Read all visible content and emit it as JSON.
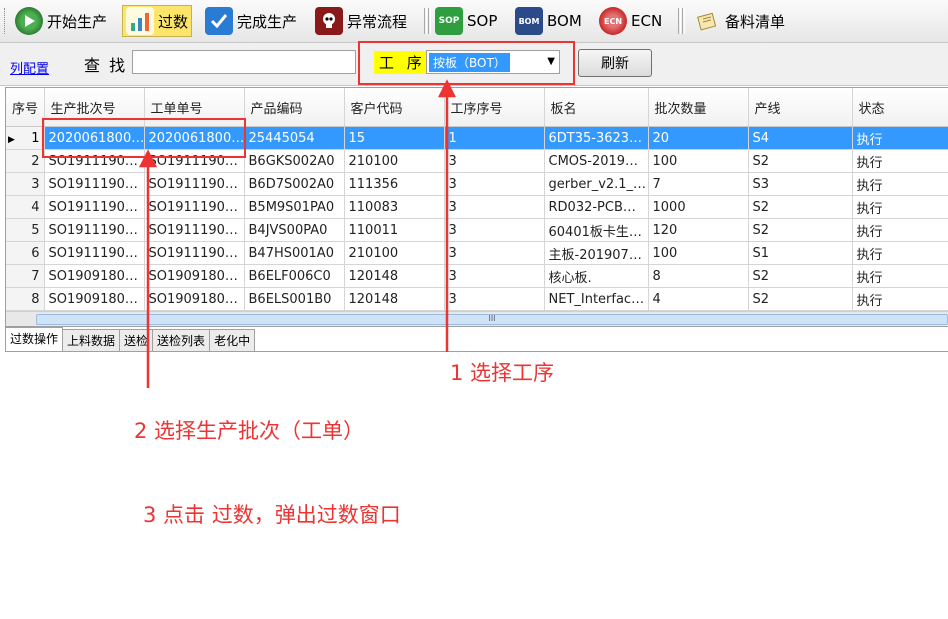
{
  "toolbar": {
    "items": [
      {
        "label": "开始生产",
        "icon": "play-icon"
      },
      {
        "label": "过数",
        "icon": "count-icon"
      },
      {
        "label": "完成生产",
        "icon": "done-icon"
      },
      {
        "label": "异常流程",
        "icon": "skull-icon"
      },
      {
        "label": "SOP",
        "icon": "sop-icon"
      },
      {
        "label": "BOM",
        "icon": "bom-icon"
      },
      {
        "label": "ECN",
        "icon": "ecn-icon"
      },
      {
        "label": "备料清单",
        "icon": "notebook-icon"
      }
    ],
    "active_index": 1
  },
  "filter": {
    "column_config_link": "列配置",
    "find_label": "查 找",
    "find_value": "",
    "process_label": "工 序",
    "process_value": "按板（BOT）",
    "refresh_label": "刷新"
  },
  "grid": {
    "columns": [
      "序号",
      "生产批次号",
      "工单单号",
      "产品编码",
      "客户代码",
      "工序序号",
      "板名",
      "批次数量",
      "产线",
      "状态"
    ],
    "rows": [
      [
        "1",
        "2020061800…",
        "2020061800…",
        "25445054",
        "15",
        "1",
        "6DT35-3623…",
        "20",
        "S4",
        "执行"
      ],
      [
        "2",
        "SO1911190…",
        "SO1911190…",
        "B6GKS002A0",
        "210100",
        "3",
        "CMOS-2019…",
        "100",
        "S2",
        "执行"
      ],
      [
        "3",
        "SO1911190…",
        "SO1911190…",
        "B6D7S002A0",
        "111356",
        "3",
        "gerber_v2.1_…",
        "7",
        "S3",
        "执行"
      ],
      [
        "4",
        "SO1911190…",
        "SO1911190…",
        "B5M9S01PA0",
        "110083",
        "3",
        "RD032-PCB…",
        "1000",
        "S2",
        "执行"
      ],
      [
        "5",
        "SO1911190…",
        "SO1911190…",
        "B4JVS00PA0",
        "110011",
        "3",
        "60401板卡生…",
        "120",
        "S2",
        "执行"
      ],
      [
        "6",
        "SO1911190…",
        "SO1911190…",
        "B47HS001A0",
        "210100",
        "3",
        "主板-201907…",
        "100",
        "S1",
        "执行"
      ],
      [
        "7",
        "SO1909180…",
        "SO1909180…",
        "B6ELF006C0",
        "120148",
        "3",
        "核心板.",
        "8",
        "S2",
        "执行"
      ],
      [
        "8",
        "SO1909180…",
        "SO1909180…",
        "B6ELS001B0",
        "120148",
        "3",
        "NET_Interfac…",
        "4",
        "S2",
        "执行"
      ]
    ],
    "selected_row": 0,
    "scroll_glyph": "III"
  },
  "tabs": [
    "过数操作",
    "上料数据",
    "送检",
    "送检列表",
    "老化中"
  ],
  "active_tab": 0,
  "annotations": {
    "step1": "1 选择工序",
    "step2": "2 选择生产批次（工单）",
    "step3": "3 点击 过数，弹出过数窗口",
    "color": "#ee3333"
  }
}
